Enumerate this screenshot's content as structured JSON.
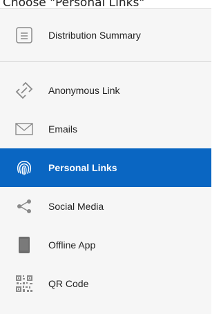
{
  "header": {
    "caption": "Choose \"Personal Links\""
  },
  "nav": {
    "summary": {
      "label": "Distribution Summary",
      "icon": "document-lines-icon"
    },
    "items": [
      {
        "label": "Anonymous Link",
        "icon": "link-icon"
      },
      {
        "label": "Emails",
        "icon": "envelope-icon"
      },
      {
        "label": "Personal Links",
        "icon": "fingerprint-icon",
        "active": true
      },
      {
        "label": "Social Media",
        "icon": "share-icon"
      },
      {
        "label": "Offline App",
        "icon": "tablet-icon"
      },
      {
        "label": "QR Code",
        "icon": "qr-code-icon"
      }
    ]
  },
  "colors": {
    "active_bg": "#0a66c2",
    "panel_bg": "#f6f6f6",
    "icon": "#8a8a8a"
  }
}
